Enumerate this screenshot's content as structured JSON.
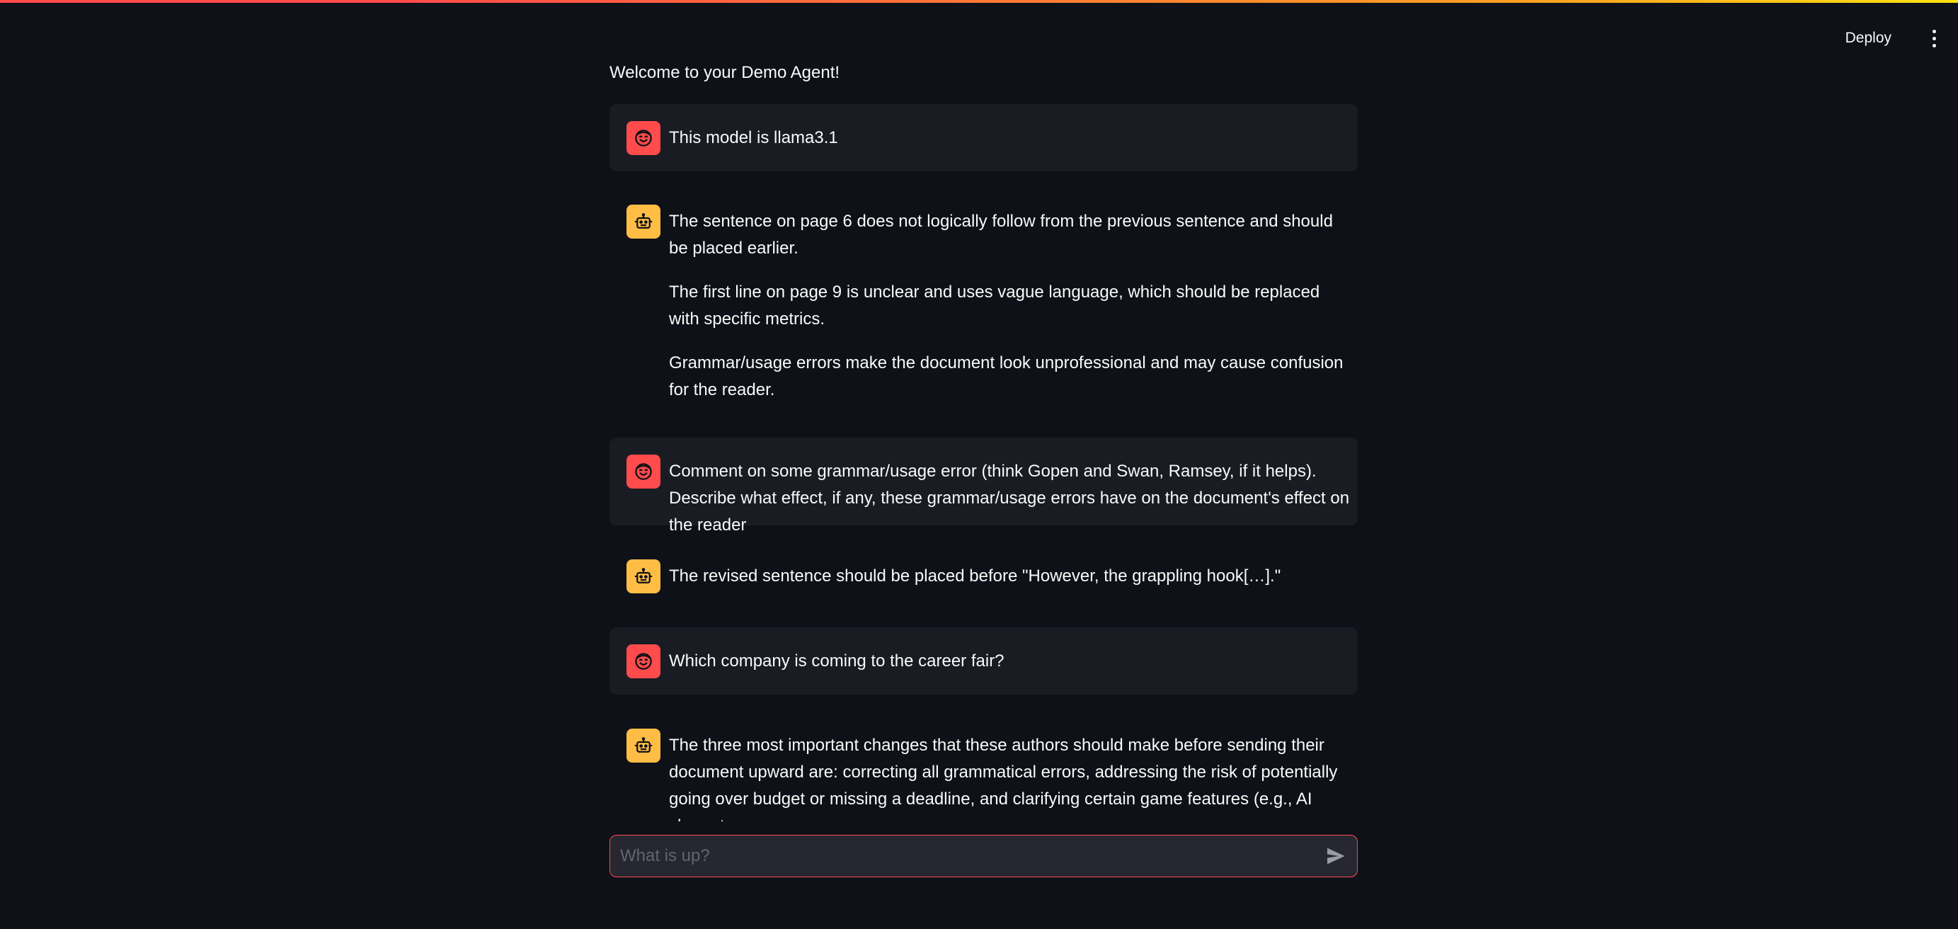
{
  "header": {
    "deploy_label": "Deploy",
    "menu_icon": "more-vertical-icon"
  },
  "welcome_text": "Welcome to your Demo Agent!",
  "colors": {
    "background": "#0e1117",
    "user_message_bg": "#1a1c24",
    "user_avatar": "#ff4b4b",
    "assistant_avatar": "#ffbd45",
    "input_border": "#ff4b4b"
  },
  "messages": [
    {
      "role": "user",
      "avatar_icon": "smiley-face-icon",
      "paragraphs": [
        "This model is llama3.1"
      ]
    },
    {
      "role": "assistant",
      "avatar_icon": "robot-icon",
      "paragraphs": [
        "The sentence on page 6 does not logically follow from the previous sentence and should be placed earlier.",
        "The first line on page 9 is unclear and uses vague language, which should be replaced with specific metrics.",
        "Grammar/usage errors make the document look unprofessional and may cause confusion for the reader."
      ]
    },
    {
      "role": "user",
      "avatar_icon": "smiley-face-icon",
      "paragraphs": [
        "Comment on some grammar/usage error (think Gopen and Swan, Ramsey, if it helps). Describe what effect, if any, these grammar/usage errors have on the document's effect on the reader"
      ]
    },
    {
      "role": "assistant",
      "avatar_icon": "robot-icon",
      "paragraphs": [
        "The revised sentence should be placed before \"However, the grappling hook[…].\""
      ]
    },
    {
      "role": "user",
      "avatar_icon": "smiley-face-icon",
      "paragraphs": [
        "Which company is coming to the career fair?"
      ]
    },
    {
      "role": "assistant",
      "avatar_icon": "robot-icon",
      "paragraphs": [
        "The three most important changes that these authors should make before sending their document upward are: correcting all grammatical errors, addressing the risk of potentially going over budget or missing a deadline, and clarifying certain game features (e.g., AI characters,"
      ]
    }
  ],
  "chat_input": {
    "placeholder": "What is up?",
    "value": "",
    "send_icon": "send-arrow-icon"
  }
}
